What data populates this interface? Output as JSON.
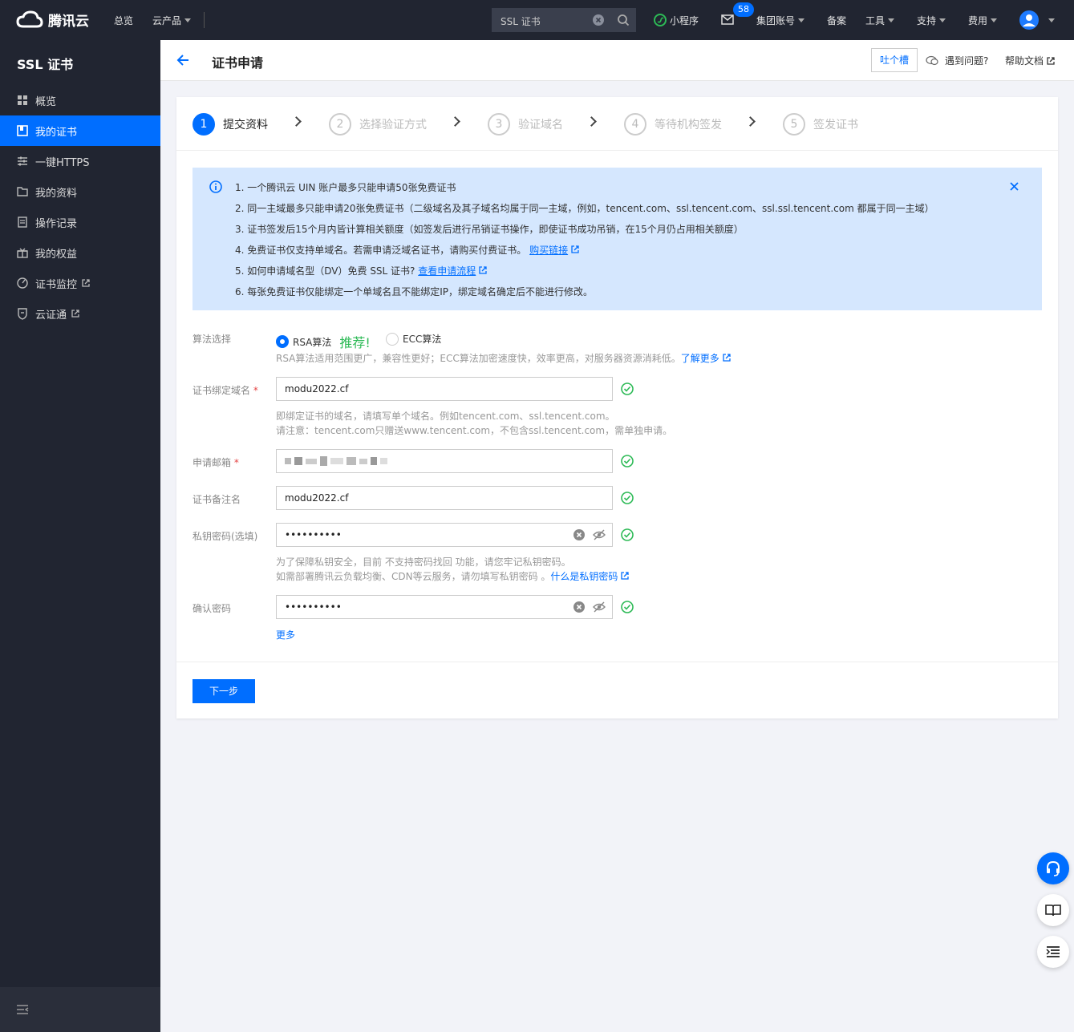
{
  "topbar": {
    "brand": "腾讯云",
    "nav": [
      "总览",
      "云产品"
    ],
    "search_value": "SSL 证书",
    "miniprogram": "小程序",
    "mail_badge": "58",
    "right_nav": [
      "集团账号",
      "备案",
      "工具",
      "支持",
      "费用"
    ]
  },
  "sidebar": {
    "title": "SSL 证书",
    "items": [
      {
        "label": "概览",
        "icon": "grid-icon"
      },
      {
        "label": "我的证书",
        "icon": "cert-icon"
      },
      {
        "label": "一键HTTPS",
        "icon": "sliders-icon"
      },
      {
        "label": "我的资料",
        "icon": "folder-icon"
      },
      {
        "label": "操作记录",
        "icon": "log-icon"
      },
      {
        "label": "我的权益",
        "icon": "gift-icon"
      },
      {
        "label": "证书监控",
        "icon": "monitor-icon"
      },
      {
        "label": "云证通",
        "icon": "shield-icon"
      }
    ]
  },
  "header": {
    "title": "证书申请",
    "feedback": "吐个槽",
    "problem": "遇到问题?",
    "help": "帮助文档"
  },
  "steps": [
    {
      "num": "1",
      "label": "提交资料"
    },
    {
      "num": "2",
      "label": "选择验证方式"
    },
    {
      "num": "3",
      "label": "验证域名"
    },
    {
      "num": "4",
      "label": "等待机构签发"
    },
    {
      "num": "5",
      "label": "签发证书"
    }
  ],
  "notice": {
    "lines": [
      "1. 一个腾讯云 UIN 账户最多只能申请50张免费证书",
      "2. 同一主域最多只能申请20张免费证书（二级域名及其子域名均属于同一主域，例如，tencent.com、ssl.tencent.com、ssl.ssl.tencent.com 都属于同一主域）",
      "3. 证书签发后15个月内皆计算相关额度（如签发后进行吊销证书操作，即使证书成功吊销，在15个月仍占用相关额度）",
      "4. 免费证书仅支持单域名。若需申请泛域名证书，请购买付费证书。",
      "5. 如何申请域名型（DV）免费 SSL 证书?",
      "6. 每张免费证书仅能绑定一个单域名且不能绑定IP，绑定域名确定后不能进行修改。"
    ],
    "buy_link": "购买链接",
    "process_link": "查看申请流程"
  },
  "form": {
    "algo_label": "算法选择",
    "algo_rsa": "RSA算法",
    "algo_recommend": "推荐!",
    "algo_ecc": "ECC算法",
    "algo_hint": "RSA算法适用范围更广，兼容性更好；ECC算法加密速度快，效率更高，对服务器资源消耗低。",
    "learn_more": "了解更多",
    "domain_label": "证书绑定域名",
    "domain_value": "modu2022.cf",
    "domain_hint1": "即绑定证书的域名，请填写单个域名。例如tencent.com、ssl.tencent.com。",
    "domain_hint2": "请注意：tencent.com只赠送www.tencent.com，不包含ssl.tencent.com，需单独申请。",
    "email_label": "申请邮箱",
    "remark_label": "证书备注名",
    "remark_value": "modu2022.cf",
    "key_label": "私钥密码(选填)",
    "key_value": "••••••••••",
    "key_hint1": "为了保障私钥安全，目前 不支持密码找回 功能，请您牢记私钥密码。",
    "key_hint2": "如需部署腾讯云负载均衡、CDN等云服务，请勿填写私钥密码 。",
    "key_link": "什么是私钥密码",
    "confirm_label": "确认密码",
    "confirm_value": "••••••••••",
    "more": "更多",
    "next": "下一步"
  }
}
